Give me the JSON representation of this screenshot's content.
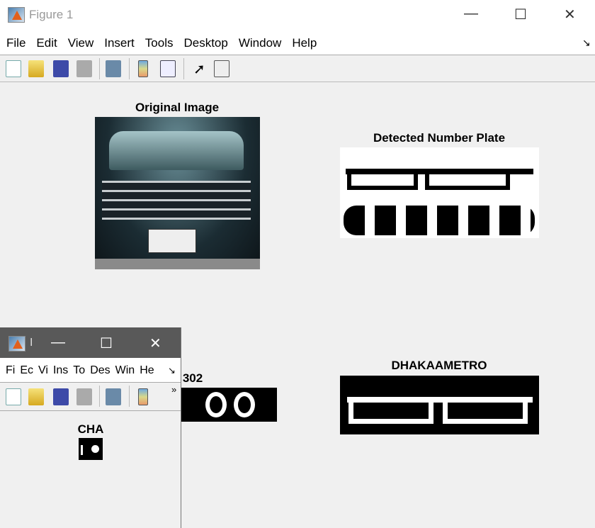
{
  "window": {
    "title": "Figure 1",
    "minimize": "—",
    "maximize": "☐",
    "close": "✕"
  },
  "menu": [
    "File",
    "Edit",
    "View",
    "Insert",
    "Tools",
    "Desktop",
    "Window",
    "Help"
  ],
  "menu_arrow": "↘",
  "toolbar_icons": [
    "new-figure-icon",
    "open-icon",
    "save-icon",
    "print-icon",
    "link-plot-icon",
    "colorbar-icon",
    "legend-icon",
    "pointer-icon",
    "property-inspector-icon"
  ],
  "axes": [
    {
      "title": "Original Image"
    },
    {
      "title": "Detected Number Plate"
    },
    {
      "title": "302"
    },
    {
      "title": "DHAKAAMETRO"
    }
  ],
  "small_window": {
    "title": "I",
    "menu": [
      "Fi",
      "Ec",
      "Vi",
      "Ins",
      "To",
      "Des",
      "Win",
      "He"
    ],
    "menu_arrow": "↘",
    "overflow": "»",
    "axes_title": "CHA"
  }
}
